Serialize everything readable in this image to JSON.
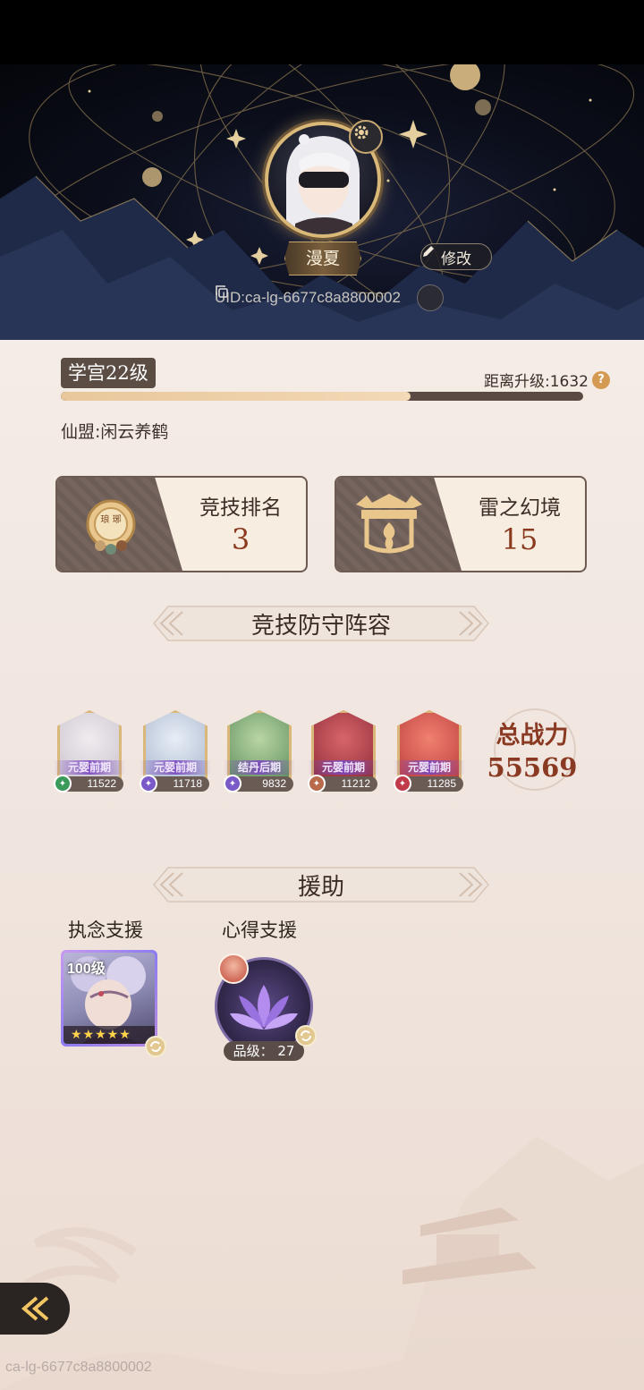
{
  "header": {
    "player_name": "漫夏",
    "edit_label": "修改",
    "uid_text": "UID:ca-lg-6677c8a8800002"
  },
  "profile": {
    "level_label": "学宫22级",
    "next_level_text": "距离升级:1632",
    "exp_progress_percent": 67,
    "alliance_text": "仙盟:闲云养鹤"
  },
  "stats": [
    {
      "label": "竞技排名",
      "value": "3",
      "icon": "arena-rank-medal-icon",
      "icon_text": "琅 琊"
    },
    {
      "label": "雷之幻境",
      "value": "15",
      "icon": "thunder-realm-gate-icon"
    }
  ],
  "defense": {
    "title": "竞技防守阵容",
    "heroes": [
      {
        "realm": "元婴前期",
        "power": "11522",
        "class_icon": "scroll-class-icon",
        "class_color": "#3a9a5a"
      },
      {
        "realm": "元婴前期",
        "power": "11718",
        "class_icon": "gourd-class-icon",
        "class_color": "#7a5ac8"
      },
      {
        "realm": "结丹后期",
        "power": "9832",
        "class_icon": "sword-class-icon",
        "class_color": "#7a5ac8"
      },
      {
        "realm": "元婴前期",
        "power": "11212",
        "class_icon": "sword-class-icon",
        "class_color": "#b86a4a"
      },
      {
        "realm": "元婴前期",
        "power": "11285",
        "class_icon": "scroll-class-icon",
        "class_color": "#c03a4a"
      }
    ],
    "total_label": "总战力",
    "total_value": "55569"
  },
  "assist": {
    "title": "援助",
    "obsession_label": "执念支援",
    "obsession_level": "100级",
    "obsession_stars": "★★★★★",
    "insight_label": "心得支援",
    "insight_grade": "品级： 27"
  },
  "footer": {
    "watermark": "ca-lg-6677c8a8800002"
  },
  "colors": {
    "accent_gold": "#d9b878",
    "value_red": "#8a3a1e",
    "panel_bg": "#f4ece6"
  }
}
